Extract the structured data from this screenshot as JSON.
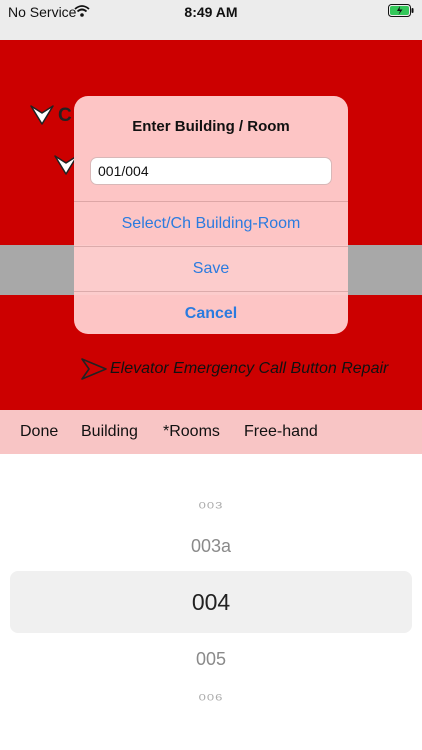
{
  "status_bar": {
    "carrier": "No Service",
    "time": "8:49 AM"
  },
  "background": {
    "row_letter": "C",
    "repair_item": "Elevator Emergency Call Button Repair"
  },
  "alert": {
    "title": "Enter Building / Room",
    "input_value": "001/004",
    "buttons": {
      "select": "Select/Ch Building-Room",
      "save": "Save",
      "cancel": "Cancel"
    }
  },
  "toolbar": {
    "done": "Done",
    "building": "Building",
    "rooms": "*Rooms",
    "freehand": "Free-hand"
  },
  "picker": {
    "items": [
      "003",
      "003a",
      "004",
      "005",
      "006"
    ],
    "selected": "004"
  },
  "colors": {
    "red": "#cc0000",
    "toolbar": "#f8c5c5",
    "accent": "#2b7bdf"
  }
}
